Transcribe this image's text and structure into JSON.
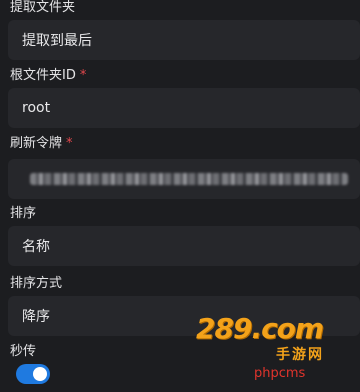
{
  "form": {
    "fields": [
      {
        "label": "提取文件夹",
        "required": false,
        "value": "提取到最后",
        "type": "select"
      },
      {
        "label": "根文件夹ID",
        "required": true,
        "value": "root",
        "type": "input"
      },
      {
        "label": "刷新令牌",
        "required": true,
        "value": "",
        "type": "masked-input"
      },
      {
        "label": "排序",
        "required": false,
        "value": "名称",
        "type": "select"
      },
      {
        "label": "排序方式",
        "required": false,
        "value": "降序",
        "type": "select"
      }
    ],
    "toggle": {
      "label": "秒传",
      "on": true,
      "color": "#1f7ae0"
    },
    "required_marker": "*",
    "required_color": "#e5484d"
  },
  "watermark": {
    "logo": "289.com",
    "sub": "手游网",
    "text": "phpcms"
  }
}
